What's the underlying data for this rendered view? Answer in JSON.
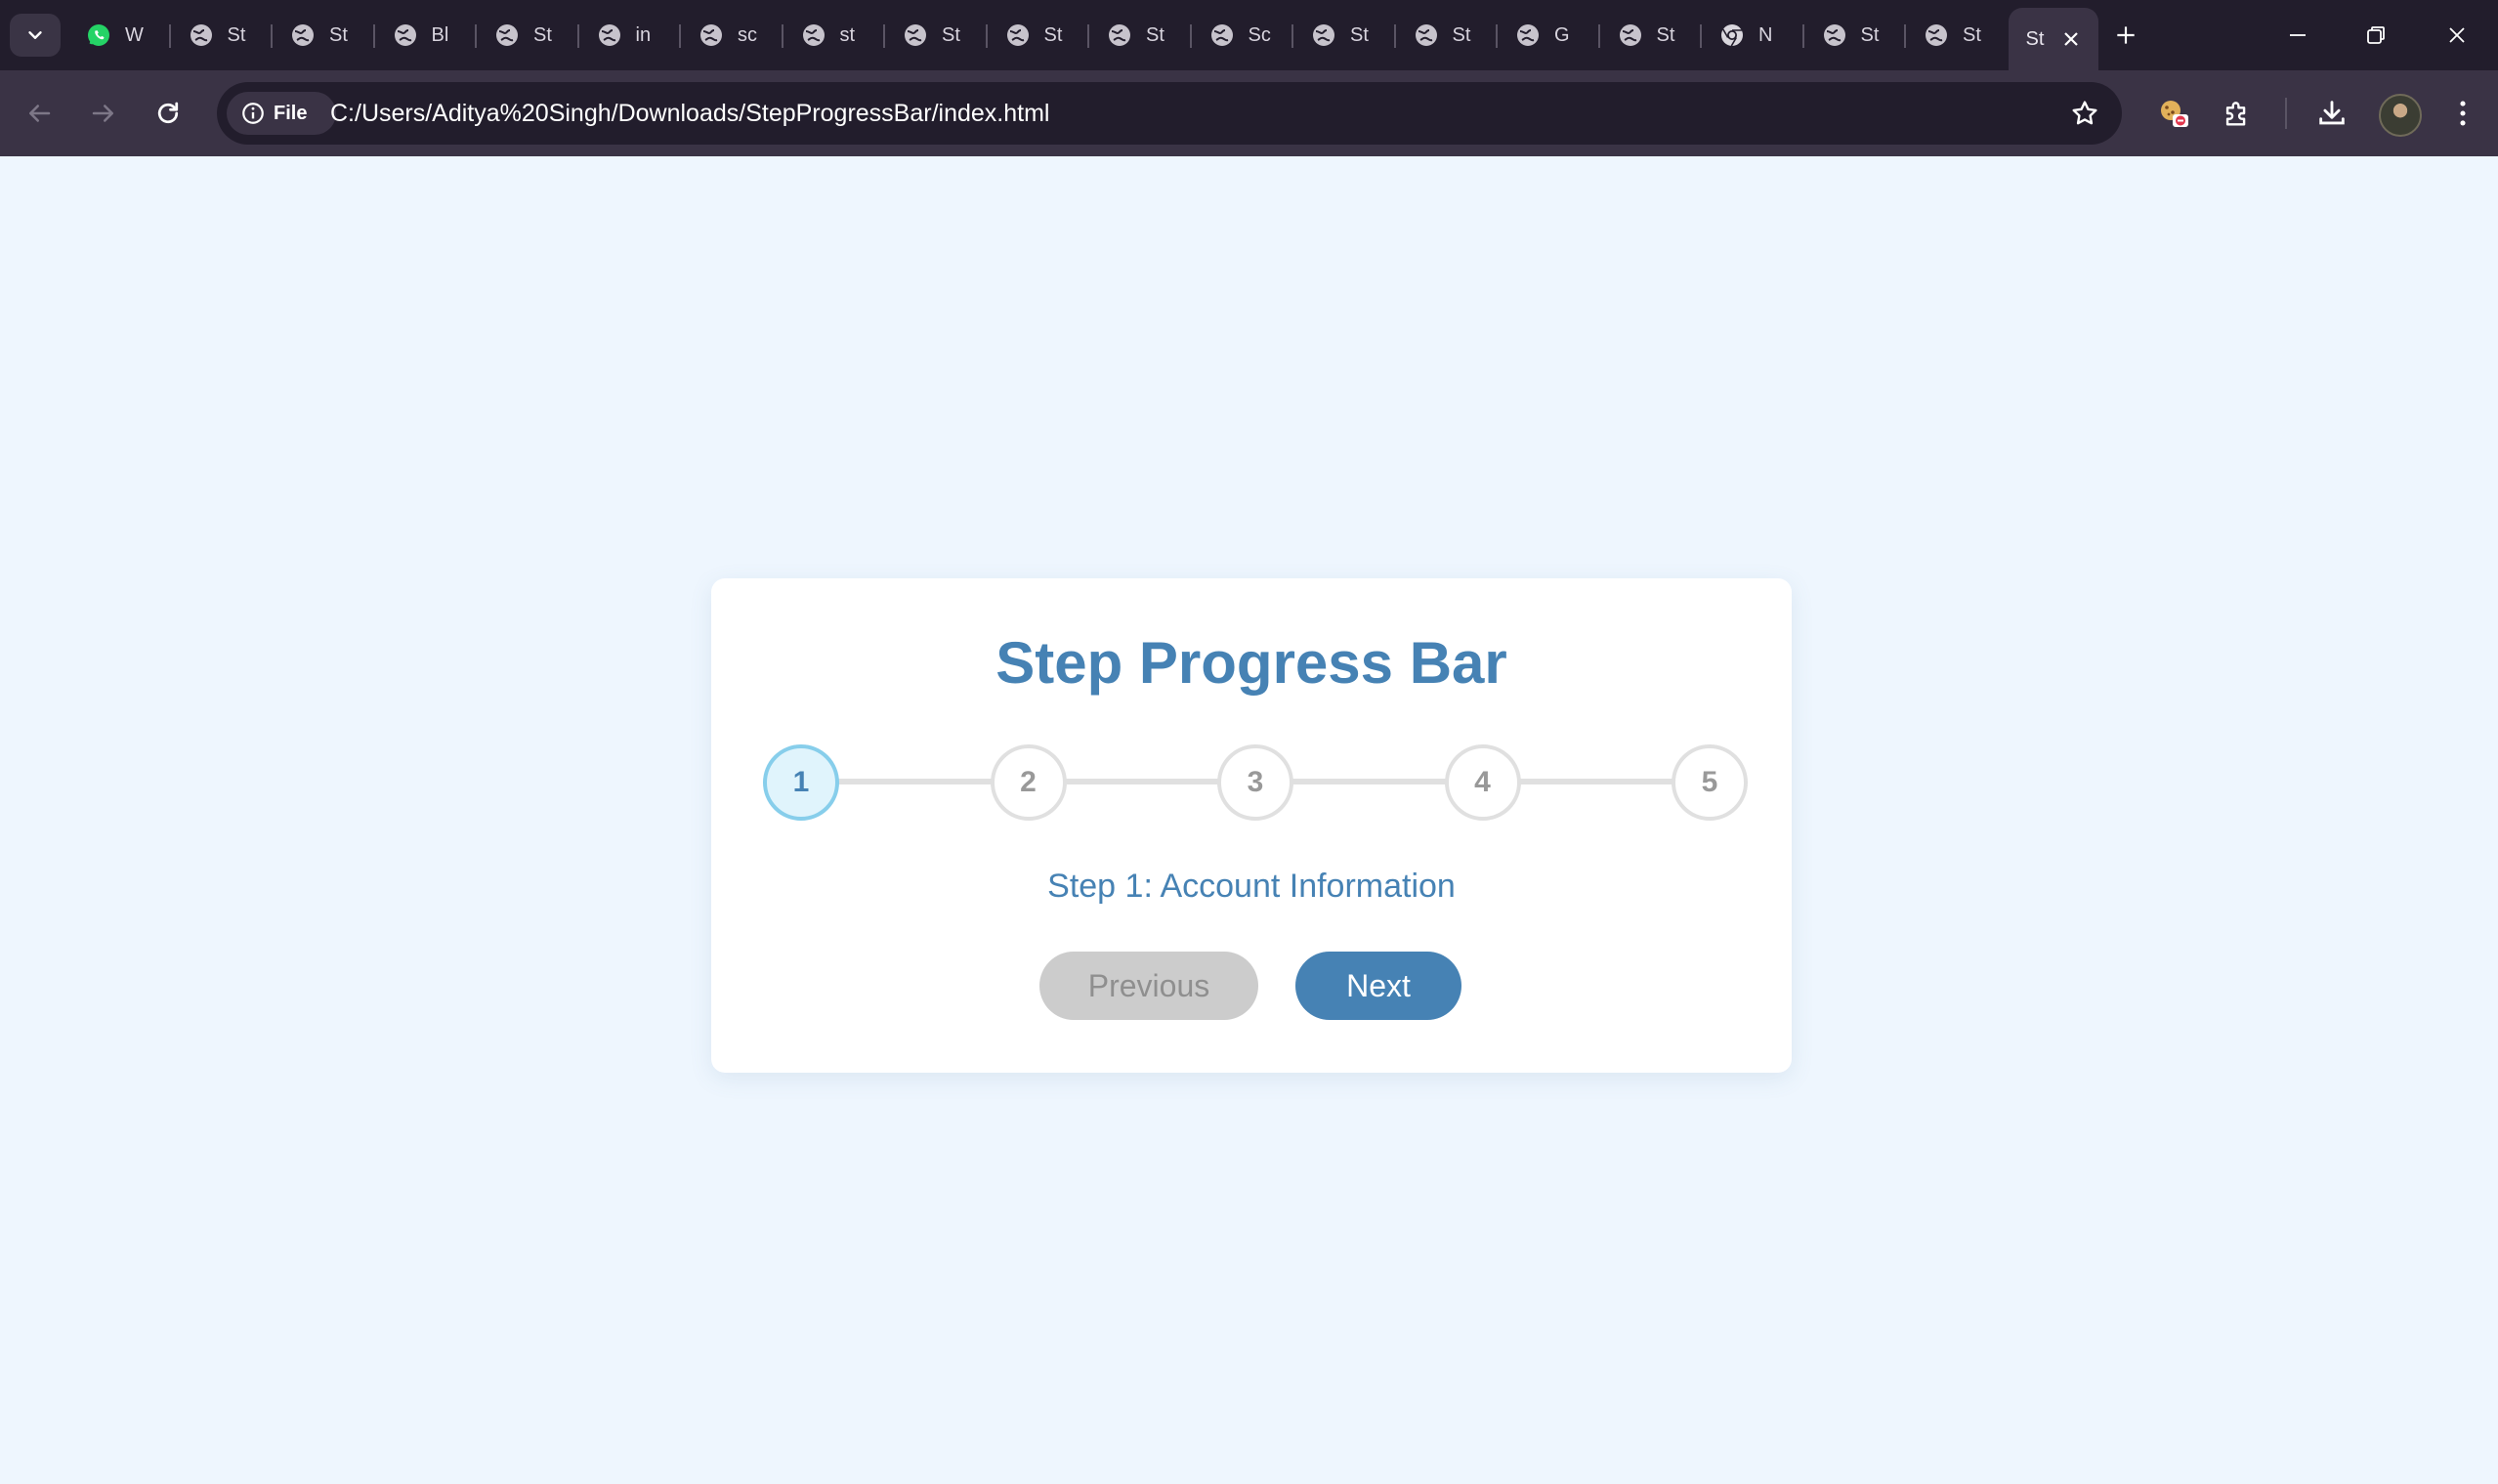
{
  "browser": {
    "tabs": [
      {
        "title": "W",
        "icon": "whatsapp-icon"
      },
      {
        "title": "St",
        "icon": "globe-icon"
      },
      {
        "title": "St",
        "icon": "globe-icon"
      },
      {
        "title": "Bl",
        "icon": "globe-icon"
      },
      {
        "title": "St",
        "icon": "globe-icon"
      },
      {
        "title": "in",
        "icon": "globe-icon"
      },
      {
        "title": "sc",
        "icon": "globe-icon"
      },
      {
        "title": "st",
        "icon": "globe-icon"
      },
      {
        "title": "St",
        "icon": "globe-icon"
      },
      {
        "title": "St",
        "icon": "globe-icon"
      },
      {
        "title": "St",
        "icon": "globe-icon"
      },
      {
        "title": "Sc",
        "icon": "globe-icon"
      },
      {
        "title": "St",
        "icon": "globe-icon"
      },
      {
        "title": "St",
        "icon": "globe-icon"
      },
      {
        "title": "G",
        "icon": "globe-icon"
      },
      {
        "title": "St",
        "icon": "globe-icon"
      },
      {
        "title": "N",
        "icon": "chrome-icon"
      },
      {
        "title": "St",
        "icon": "globe-icon"
      },
      {
        "title": "St",
        "icon": "globe-icon"
      }
    ],
    "active_tab": {
      "title": "St"
    },
    "address": {
      "chip_label": "File",
      "url": "C:/Users/Aditya%20Singh/Downloads/StepProgressBar/index.html"
    }
  },
  "page": {
    "title": "Step Progress Bar",
    "steps": [
      "1",
      "2",
      "3",
      "4",
      "5"
    ],
    "current_step": 1,
    "step_label": "Step 1: Account Information",
    "buttons": {
      "previous": "Previous",
      "next": "Next"
    }
  },
  "colors": {
    "accent": "#4682b4",
    "active_step_border": "#87ceeb",
    "background": "#eef6fe"
  }
}
